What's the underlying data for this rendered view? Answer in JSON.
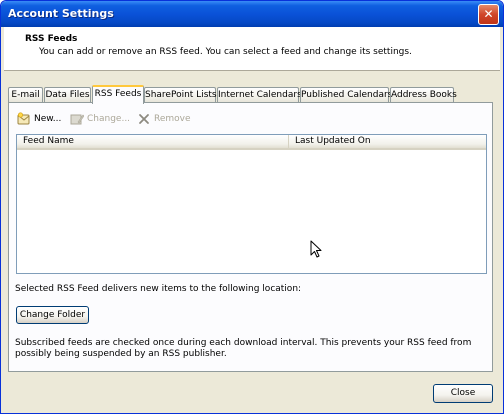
{
  "window": {
    "title": "Account Settings"
  },
  "header": {
    "title": "RSS Feeds",
    "description": "You can add or remove an RSS feed. You can select a feed and change its settings."
  },
  "tabs": [
    {
      "label": "E-mail"
    },
    {
      "label": "Data Files"
    },
    {
      "label": "RSS Feeds",
      "active": true
    },
    {
      "label": "SharePoint Lists"
    },
    {
      "label": "Internet Calendars"
    },
    {
      "label": "Published Calendars"
    },
    {
      "label": "Address Books"
    }
  ],
  "toolbar": {
    "new_label": "New...",
    "change_label": "Change...",
    "remove_label": "Remove"
  },
  "list": {
    "columns": [
      "Feed Name",
      "Last Updated On"
    ],
    "rows": []
  },
  "location_text": "Selected RSS Feed delivers new items to the following location:",
  "change_folder_label": "Change Folder",
  "subscribed_text": "Subscribed feeds are checked once during each download interval. This prevents your RSS feed from possibly being suspended by an RSS publisher.",
  "close_label": "Close",
  "colors": {
    "titlebar": "#0a52d8",
    "dialog_bg": "#ece9d8",
    "active_tab_accent": "#ffc83c"
  }
}
